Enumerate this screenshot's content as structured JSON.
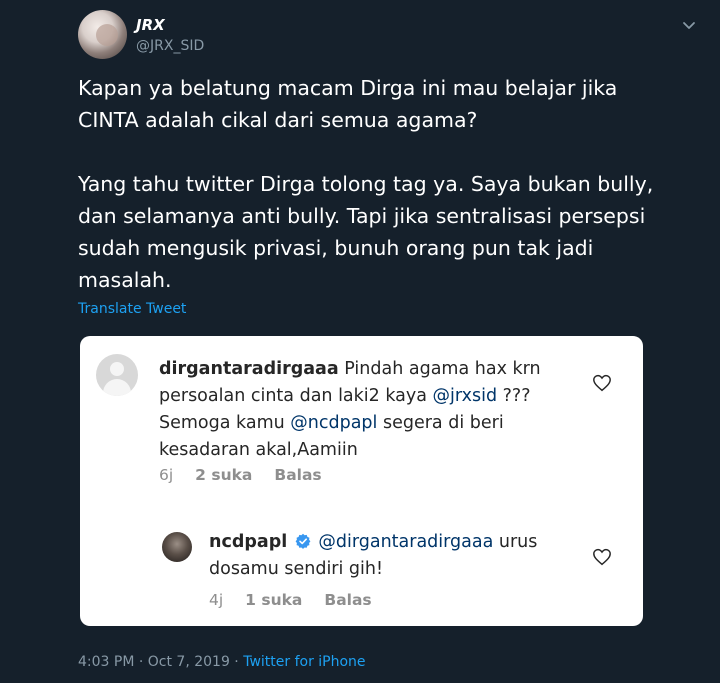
{
  "tweet": {
    "author_name": "JRX",
    "author_handle": "@JRX_SID",
    "text": "Kapan ya belatung macam Dirga ini mau belajar jika CINTA adalah cikal dari semua agama?\n\nYang tahu twitter Dirga tolong tag ya. Saya bukan bully, dan selamanya anti bully. Tapi jika sentralisasi persepsi sudah mengusik privasi, bunuh orang pun tak jadi masalah.",
    "translate_label": "Translate Tweet",
    "timestamp": "4:03 PM · Oct 7, 2019 · ",
    "source": "Twitter for iPhone"
  },
  "screenshot": {
    "comment1": {
      "username": "dirgantaradirgaaa",
      "text_a": " Pindah agama hax krn persoalan cinta dan laki2 kaya ",
      "mention1": "@jrxsid",
      "text_b": " ??? Semoga kamu ",
      "mention2": "@ncdpapl",
      "text_c": " segera di beri kesadaran akal,Aamiin",
      "time": "6j",
      "likes": "2 suka",
      "reply": "Balas"
    },
    "comment2": {
      "username": "ncdpapl",
      "mention": "@dirgantaradirgaaa",
      "text": " urus dosamu sendiri gih!",
      "time": "4j",
      "likes": "1 suka",
      "reply": "Balas"
    }
  },
  "colors": {
    "background": "#15202b",
    "link": "#1da1f2",
    "muted": "#8899a6",
    "ig_verified": "#3897f0"
  },
  "icons": [
    "chevron-down-icon",
    "heart-icon",
    "verified-badge-icon"
  ]
}
